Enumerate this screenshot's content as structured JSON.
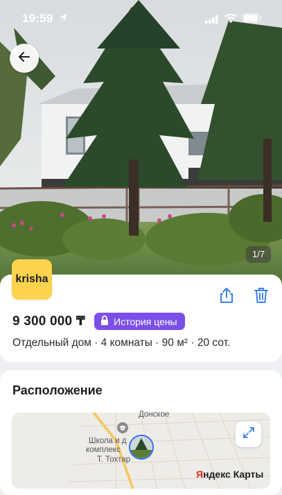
{
  "status_bar": {
    "time": "19:59",
    "icons": [
      "location-arrow-icon",
      "cellular-signal-icon",
      "wifi-icon",
      "battery-icon"
    ]
  },
  "gallery": {
    "counter": "1/7",
    "back_icon": "arrow-left-icon"
  },
  "listing": {
    "brand_logo": "krisha",
    "price": "9 300 000 ₸",
    "price_history_button": "История цены",
    "price_history_icon": "lock-icon",
    "specs": "Отдельный дом · 4 комнаты · 90 м² · 20 сот.",
    "actions": {
      "share_icon": "share-icon",
      "delete_icon": "trash-icon"
    }
  },
  "location": {
    "title": "Расположение",
    "map_labels": {
      "village": "Донское",
      "school_line1": "Школа и д",
      "school_line2": "комплекс",
      "school_line3": "Т. Тохтар"
    },
    "map_brand_part1": "Я",
    "map_brand_part2": "ндекс Карты",
    "expand_icon": "expand-arrows-icon"
  },
  "colors": {
    "accent_purple": "#7b4fe8",
    "brand_yellow": "#fcd34d",
    "icon_blue": "#3d7fe6",
    "yandex_red": "#e2261c"
  }
}
